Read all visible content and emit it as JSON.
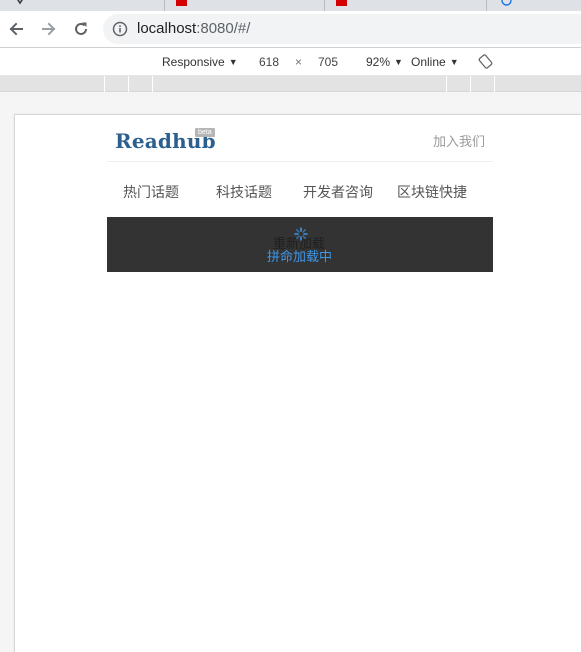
{
  "browser": {
    "url_host": "localhost",
    "url_path": ":8080/#/"
  },
  "device_toolbar": {
    "device": "Responsive",
    "width": "618",
    "times": "×",
    "height": "705",
    "zoom": "92%",
    "network": "Online"
  },
  "site": {
    "logo": "Readhub",
    "beta": "beta",
    "join": "加入我们",
    "nav": [
      "热门话题",
      "科技话题",
      "开发者咨询",
      "区块链快捷"
    ],
    "loading_ghost": "重新加载",
    "loading_text": "拼命加载中"
  },
  "colors": {
    "logo": "#2a5f8e",
    "loading_bg": "#333333",
    "loading_text": "#3e97e8"
  }
}
